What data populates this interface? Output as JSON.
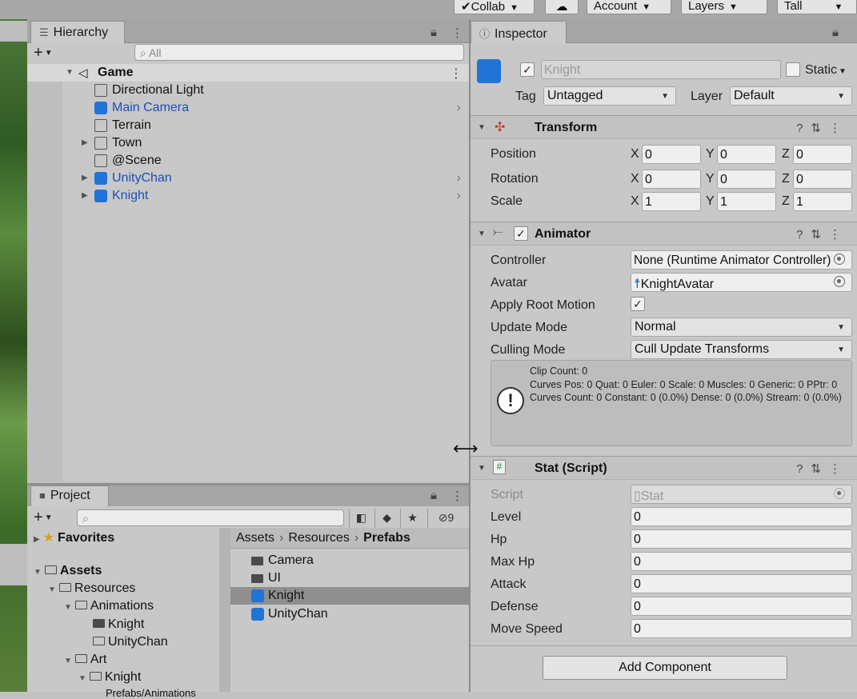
{
  "toolbar": {
    "collab_label": "Collab",
    "account_label": "Account",
    "layers_label": "Layers",
    "layout_label": "Tall"
  },
  "hierarchy": {
    "tab_label": "Hierarchy",
    "search_placeholder": "All",
    "scene_name": "Game",
    "items": [
      {
        "label": "Directional Light",
        "prefab": false,
        "has_children": false
      },
      {
        "label": "Main Camera",
        "prefab": true,
        "has_children": false
      },
      {
        "label": "Terrain",
        "prefab": false,
        "has_children": false
      },
      {
        "label": "Town",
        "prefab": false,
        "has_children": true
      },
      {
        "label": "@Scene",
        "prefab": false,
        "has_children": false
      },
      {
        "label": "UnityChan",
        "prefab": true,
        "has_children": true
      },
      {
        "label": "Knight",
        "prefab": true,
        "has_children": true
      }
    ]
  },
  "project": {
    "tab_label": "Project",
    "hidden_count": "9",
    "favorites_label": "Favorites",
    "tree": {
      "assets": "Assets",
      "resources": "Resources",
      "animations": "Animations",
      "anim_knight": "Knight",
      "anim_unitychan": "UnityChan",
      "art": "Art",
      "art_knight": "Knight",
      "art_partial": "Prefabs/Animations"
    },
    "breadcrumb": [
      "Assets",
      "Resources",
      "Prefabs"
    ],
    "assets": [
      {
        "label": "Camera",
        "type": "folder"
      },
      {
        "label": "UI",
        "type": "folder"
      },
      {
        "label": "Knight",
        "type": "prefab",
        "selected": true
      },
      {
        "label": "UnityChan",
        "type": "prefab"
      }
    ]
  },
  "inspector": {
    "tab_label": "Inspector",
    "object_name": "Knight",
    "static_label": "Static",
    "tag_label": "Tag",
    "tag_value": "Untagged",
    "layer_label": "Layer",
    "layer_value": "Default",
    "transform": {
      "title": "Transform",
      "rows": [
        {
          "label": "Position",
          "x": "0",
          "y": "0",
          "z": "0"
        },
        {
          "label": "Rotation",
          "x": "0",
          "y": "0",
          "z": "0"
        },
        {
          "label": "Scale",
          "x": "1",
          "y": "1",
          "z": "1"
        }
      ],
      "axis_x": "X",
      "axis_y": "Y",
      "axis_z": "Z"
    },
    "animator": {
      "title": "Animator",
      "controller_label": "Controller",
      "controller_value": "None (Runtime Animator Controller)",
      "avatar_label": "Avatar",
      "avatar_value": "KnightAvatar",
      "apply_root_motion_label": "Apply Root Motion",
      "update_mode_label": "Update Mode",
      "update_mode_value": "Normal",
      "culling_mode_label": "Culling Mode",
      "culling_mode_value": "Cull Update Transforms",
      "info_lines": [
        "Clip Count: 0",
        "Curves Pos: 0 Quat: 0 Euler: 0 Scale: 0 Muscles: 0 Generic: 0 PPtr: 0",
        "Curves Count: 0 Constant: 0 (0.0%) Dense: 0 (0.0%) Stream: 0 (0.0%)"
      ]
    },
    "stat": {
      "title": "Stat (Script)",
      "script_label": "Script",
      "script_value": "Stat",
      "fields": [
        {
          "label": "Level",
          "value": "0"
        },
        {
          "label": "Hp",
          "value": "0"
        },
        {
          "label": "Max Hp",
          "value": "0"
        },
        {
          "label": "Attack",
          "value": "0"
        },
        {
          "label": "Defense",
          "value": "0"
        },
        {
          "label": "Move Speed",
          "value": "0"
        }
      ]
    },
    "add_component_label": "Add Component"
  },
  "colors": {
    "prefab_blue": "#1b4fb8",
    "cube_blue": "#1f74d6",
    "panel_bg": "#c8c8c8"
  }
}
